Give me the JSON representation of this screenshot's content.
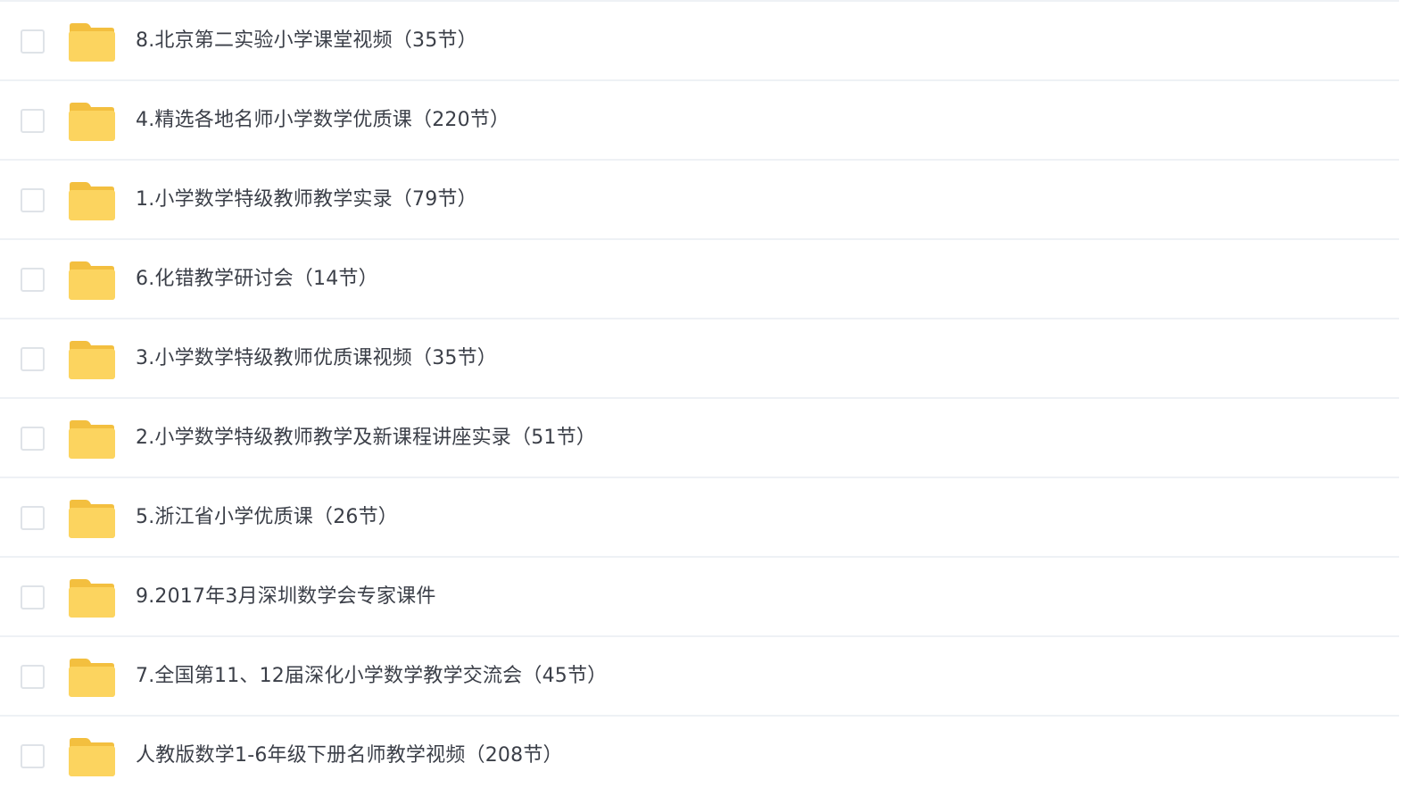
{
  "file_list": {
    "items": [
      {
        "name": "8.北京第二实验小学课堂视频（35节）",
        "icon": "folder-icon"
      },
      {
        "name": "4.精选各地名师小学数学优质课（220节）",
        "icon": "folder-icon"
      },
      {
        "name": "1.小学数学特级教师教学实录（79节）",
        "icon": "folder-icon"
      },
      {
        "name": "6.化错教学研讨会（14节）",
        "icon": "folder-icon"
      },
      {
        "name": "3.小学数学特级教师优质课视频（35节）",
        "icon": "folder-icon"
      },
      {
        "name": "2.小学数学特级教师教学及新课程讲座实录（51节）",
        "icon": "folder-icon"
      },
      {
        "name": "5.浙江省小学优质课（26节）",
        "icon": "folder-icon"
      },
      {
        "name": "9.2017年3月深圳数学会专家课件",
        "icon": "folder-icon"
      },
      {
        "name": "7.全国第11、12届深化小学数学教学交流会（45节）",
        "icon": "folder-icon"
      },
      {
        "name": "人教版数学1-6年级下册名师教学视频（208节）",
        "icon": "folder-icon"
      }
    ]
  },
  "colors": {
    "folder_front": "#fcd45f",
    "folder_back": "#f3bf3f",
    "text": "#3b3f48",
    "divider": "#eef1f5",
    "checkbox_border": "#dfe3e8"
  }
}
